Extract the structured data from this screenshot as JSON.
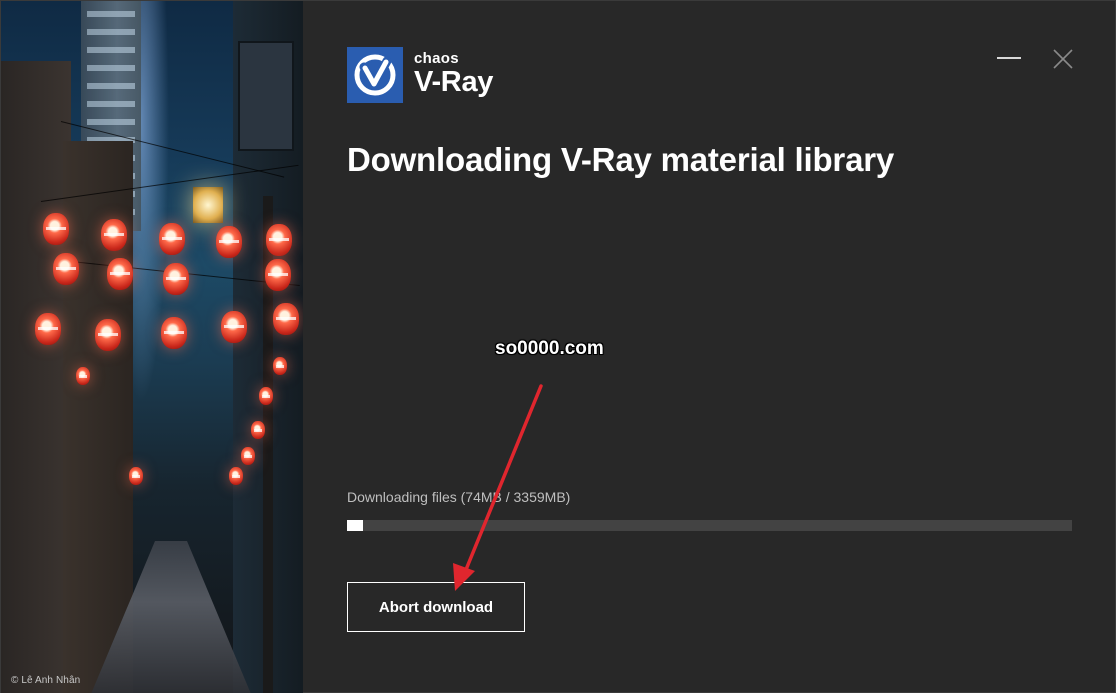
{
  "window": {
    "photo_credit": "© Lê Anh Nhân"
  },
  "logo": {
    "brand": "chaos",
    "product": "V-Ray",
    "accent": "#2a5db0"
  },
  "title": "Downloading V-Ray material library",
  "progress": {
    "label": "Downloading files (74MB / 3359MB)",
    "downloaded_mb": 74,
    "total_mb": 3359,
    "fraction": 0.022
  },
  "buttons": {
    "abort": "Abort download"
  },
  "controls": {
    "minimize": "minimize-icon",
    "close": "close-icon"
  },
  "watermark": "so0000.com",
  "annotation_color": "#e0262e"
}
